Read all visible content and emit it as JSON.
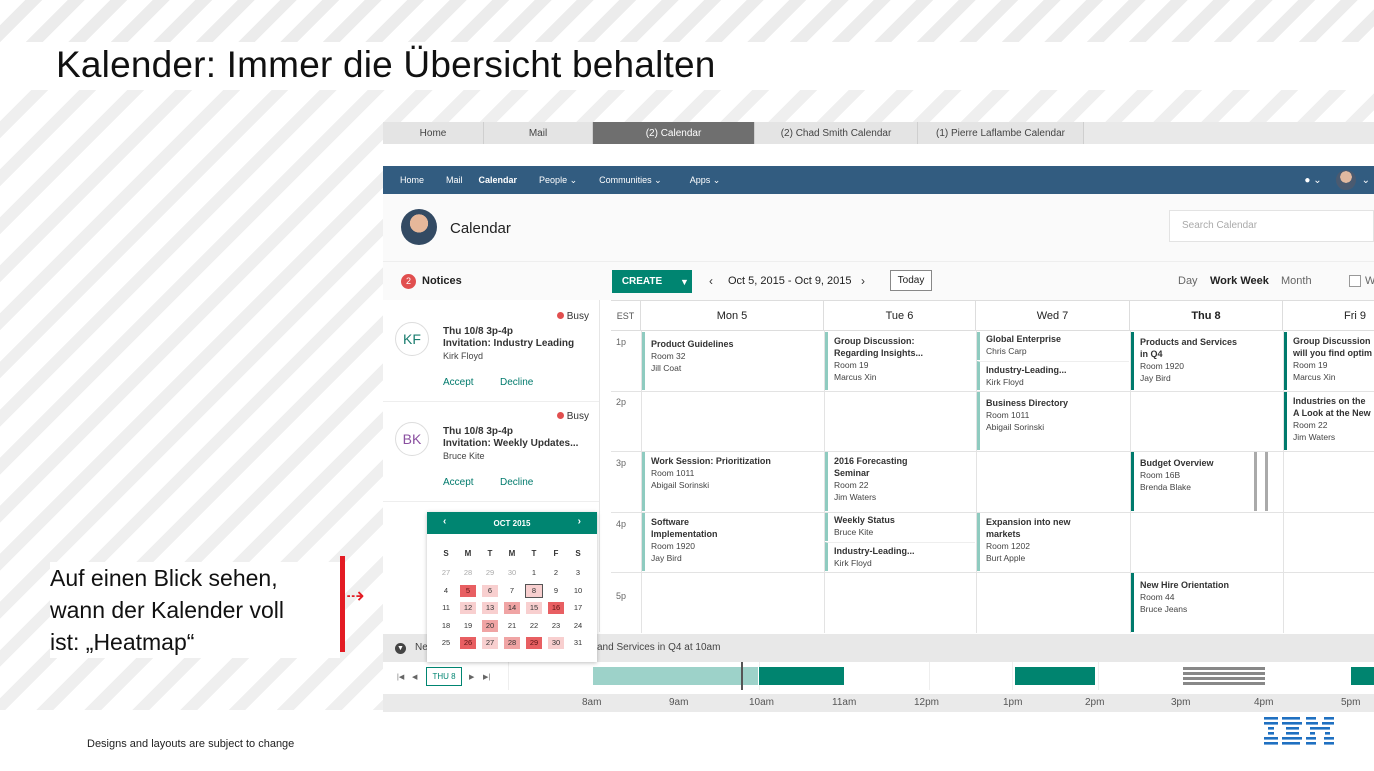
{
  "slide": {
    "title": "Kalender: Immer die Übersicht behalten",
    "caption_lines": [
      "Auf einen Blick sehen,",
      "wann der Kalender voll",
      "ist: „Heatmap“"
    ],
    "footer": "Designs and layouts are subject to change",
    "logo": "IBM"
  },
  "browser_tabs": [
    "Home",
    "Mail",
    "(2) Calendar",
    "(2) Chad Smith Calendar",
    "(1) Pierre Laflambe Calendar"
  ],
  "nav": {
    "items": [
      "Home",
      "Mail",
      "Calendar",
      "People ⌄",
      "Communities ⌄",
      "Apps ⌄"
    ],
    "right_icons": [
      "chat-icon",
      "avatar-menu"
    ]
  },
  "header": {
    "title": "Calendar",
    "search_placeholder": "Search Calendar"
  },
  "notices": {
    "count": "2",
    "label": "Notices",
    "items": [
      {
        "initials": "KF",
        "status": "Busy",
        "when": "Thu 10/8  3p-4p",
        "subject": "Invitation: Industry Leading",
        "who": "Kirk Floyd",
        "accept": "Accept",
        "decline": "Decline"
      },
      {
        "initials": "BK",
        "status": "Busy",
        "when": "Thu 10/8  3p-4p",
        "subject": "Invitation: Weekly Updates...",
        "who": "Bruce Kite",
        "accept": "Accept",
        "decline": "Decline"
      }
    ]
  },
  "toolbar": {
    "create": "CREATE",
    "range": "Oct 5, 2015 - Oct 9, 2015",
    "today": "Today",
    "views": [
      "Day",
      "Work Week",
      "Month"
    ],
    "selected_view": "Work Week",
    "w_label": "W"
  },
  "grid": {
    "tz": "EST",
    "days": [
      "Mon 5",
      "Tue 6",
      "Wed 7",
      "Thu 8",
      "Fri 9"
    ],
    "hours": [
      "1p",
      "2p",
      "3p",
      "4p",
      "5p"
    ],
    "events": {
      "mon_1": {
        "t": "Product Guidelines",
        "l1": "Room 32",
        "l2": "Jill Coat"
      },
      "tue_1": {
        "t": "Group Discussion:",
        "t2": "Regarding Insights...",
        "l1": "Room 19",
        "l2": "Marcus Xin"
      },
      "wed_1a": {
        "t": "Global Enterprise",
        "l1": "Chris Carp"
      },
      "wed_1b": {
        "t": "Industry-Leading...",
        "l1": "Kirk Floyd"
      },
      "thu_1": {
        "t": "Products and Services",
        "t2": "in Q4",
        "l1": "Room 1920",
        "l2": "Jay Bird"
      },
      "fri_1": {
        "t": "Group Discussion",
        "t2": "will you find optim",
        "l1": "Room 19",
        "l2": "Marcus Xin"
      },
      "wed_2": {
        "t": "Business Directory",
        "l1": "Room 1011",
        "l2": "Abigail Sorinski"
      },
      "fri_2": {
        "t": "Industries on the",
        "t2": "A Look at the New",
        "l1": "Room 22",
        "l2": "Jim Waters"
      },
      "mon_3": {
        "t": "Work Session: Prioritization",
        "l1": "Room 1011",
        "l2": "Abigail Sorinski"
      },
      "tue_3": {
        "t": "2016 Forecasting",
        "t2": "Seminar",
        "l1": "Room 22",
        "l2": "Jim Waters"
      },
      "thu_3": {
        "t": "Budget Overview",
        "l1": "Room 16B",
        "l2": "Brenda Blake"
      },
      "mon_4": {
        "t": "Software",
        "t2": "Implementation",
        "l1": "Room 1920",
        "l2": "Jay Bird"
      },
      "tue_4a": {
        "t": "Weekly Status",
        "l1": "Bruce Kite"
      },
      "tue_4b": {
        "t": "Industry-Leading...",
        "l1": "Kirk Floyd"
      },
      "wed_4": {
        "t": "Expansion into new",
        "t2": "markets",
        "l1": "Room 1202",
        "l2": "Burt Apple"
      },
      "thu_5": {
        "t": "New Hire Orientation",
        "l1": "Room 44",
        "l2": "Bruce Jeans"
      }
    }
  },
  "next_bar": {
    "prefix": "Ne",
    "text": "and Services in Q4 at 10am"
  },
  "timeline": {
    "current": "THU 8",
    "ticks": [
      "8am",
      "9am",
      "10am",
      "11am",
      "12pm",
      "1pm",
      "2pm",
      "3pm",
      "4pm",
      "5pm"
    ]
  },
  "mini_cal": {
    "month": "OCT 2015",
    "dow": [
      "S",
      "M",
      "T",
      "M",
      "T",
      "F",
      "S"
    ],
    "weeks": [
      [
        "27",
        "28",
        "29",
        "30",
        "1",
        "2",
        "3"
      ],
      [
        "4",
        "5",
        "6",
        "7",
        "8",
        "9",
        "10"
      ],
      [
        "11",
        "12",
        "13",
        "14",
        "15",
        "16",
        "17"
      ],
      [
        "18",
        "19",
        "20",
        "21",
        "22",
        "23",
        "24"
      ],
      [
        "25",
        "26",
        "27",
        "28",
        "29",
        "30",
        "31"
      ]
    ],
    "heat": [
      [
        0,
        0,
        0,
        0,
        0,
        0,
        0
      ],
      [
        0,
        3,
        1,
        0,
        1,
        0,
        0
      ],
      [
        0,
        1,
        1,
        2,
        1,
        3,
        0
      ],
      [
        0,
        0,
        2,
        0,
        0,
        0,
        0
      ],
      [
        0,
        3,
        1,
        2,
        3,
        1,
        0
      ]
    ],
    "colors": {
      "0": "#ffffff",
      "1": "#f8cfcf",
      "2": "#f0a4a4",
      "3": "#e85f62"
    }
  },
  "colors": {
    "nav": "#325c80",
    "accent": "#008571",
    "busy": "#e14f4f",
    "heat": "#e85f62"
  }
}
